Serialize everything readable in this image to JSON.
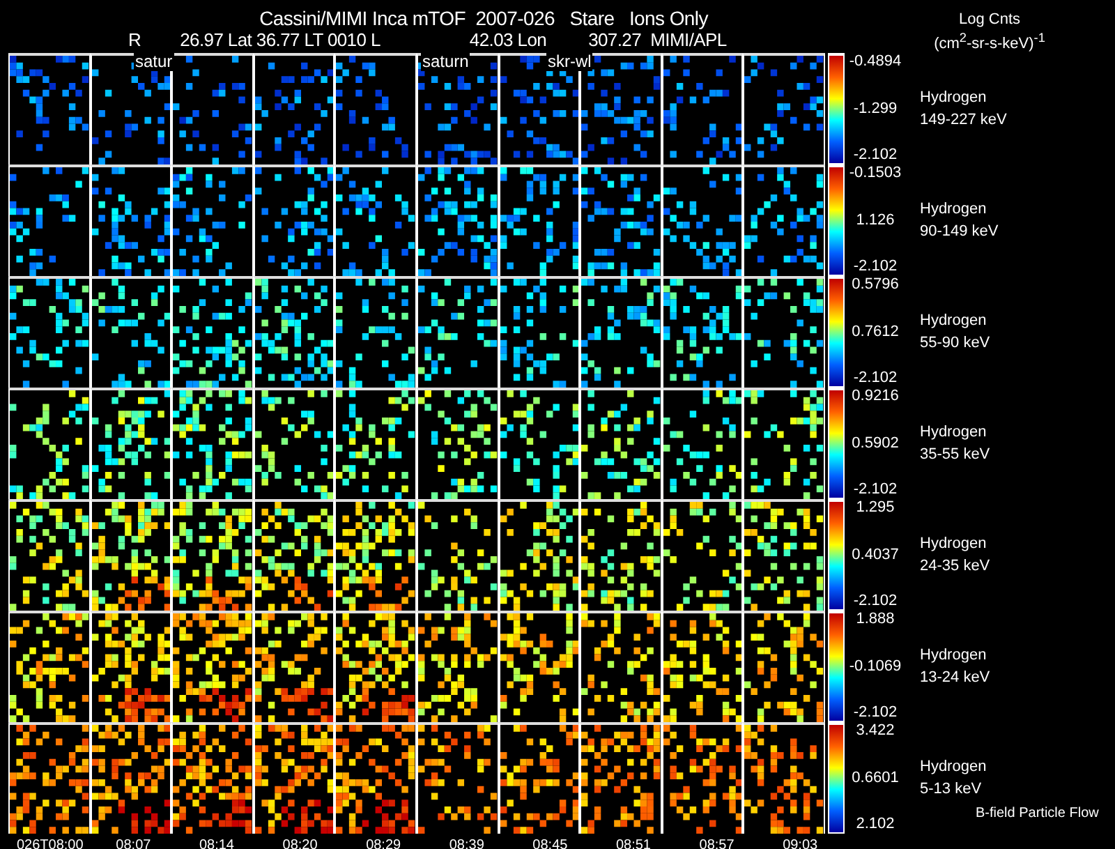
{
  "title": "Cassini/MIMI Inca mTOF  2007-026   Stare   Ions Only",
  "ephemeris": [
    "R",
    "26.97 Lat 36.77 LT 0010 L",
    "42.03 Lon",
    "307.27  MIMI/APL"
  ],
  "color_scale": {
    "title": "Log Cnts",
    "units": "(cm$^{2}$-sr-s-keV)$^{-1}$"
  },
  "overlay_labels": [
    "satur",
    "saturn",
    "skr-wl"
  ],
  "panels": [
    {
      "species": "Hydrogen",
      "energy": "149-227 keV",
      "scale_max": "-0.4894",
      "scale_mid": "-1.299",
      "scale_min": "-2.102"
    },
    {
      "species": "Hydrogen",
      "energy": "90-149 keV",
      "scale_max": "-0.1503",
      "scale_mid": "1.126",
      "scale_min": "-2.102"
    },
    {
      "species": "Hydrogen",
      "energy": "55-90 keV",
      "scale_max": "0.5796",
      "scale_mid": "0.7612",
      "scale_min": "-2.102"
    },
    {
      "species": "Hydrogen",
      "energy": "35-55 keV",
      "scale_max": "0.9216",
      "scale_mid": "0.5902",
      "scale_min": "-2.102"
    },
    {
      "species": "Hydrogen",
      "energy": "24-35 keV",
      "scale_max": "1.295",
      "scale_mid": "0.4037",
      "scale_min": "-2.102"
    },
    {
      "species": "Hydrogen",
      "energy": "13-24 keV",
      "scale_max": "1.888",
      "scale_mid": "-0.1069",
      "scale_min": "-2.102"
    },
    {
      "species": "Hydrogen",
      "energy": "5-13 keV",
      "scale_max": "3.422",
      "scale_mid": "0.6601",
      "scale_min": "2.102"
    }
  ],
  "legend": "B-field Particle Flow",
  "time_ticks": [
    "026T08:00",
    "08:07",
    "08:14",
    "08:20",
    "08:29",
    "08:39",
    "08:45",
    "08:51",
    "08:57",
    "09:03"
  ]
}
